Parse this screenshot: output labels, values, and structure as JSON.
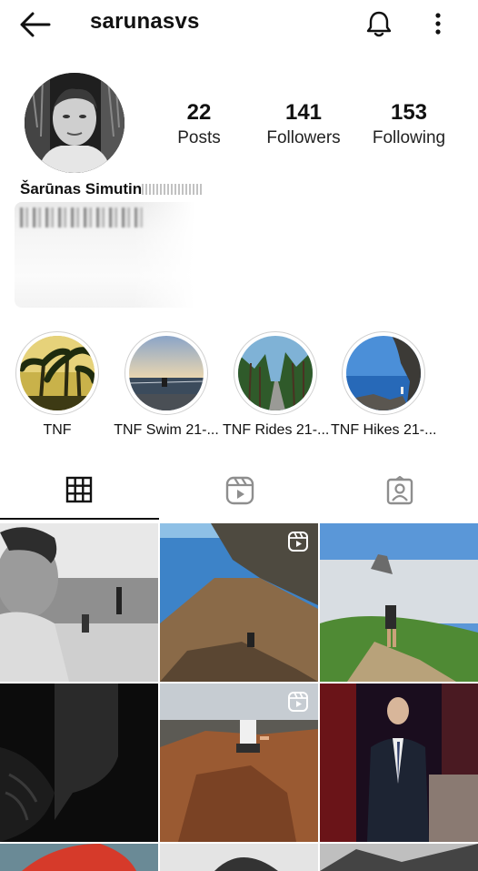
{
  "header": {
    "username": "sarunasvs",
    "icons": {
      "back": "arrow-left-icon",
      "notifications": "bell-icon",
      "more": "more-vertical-icon"
    }
  },
  "profile": {
    "full_name": "Šarūnas Simutin",
    "stats": {
      "posts": {
        "value": "22",
        "label": "Posts"
      },
      "followers": {
        "value": "141",
        "label": "Followers"
      },
      "following": {
        "value": "153",
        "label": "Following"
      }
    }
  },
  "highlights": [
    {
      "label": "TNF"
    },
    {
      "label": "TNF Swim 21-..."
    },
    {
      "label": "TNF Rides 21-..."
    },
    {
      "label": "TNF Hikes 21-..."
    }
  ],
  "tabs": [
    {
      "icon": "grid-icon",
      "active": true
    },
    {
      "icon": "reels-icon",
      "active": false
    },
    {
      "icon": "tagged-icon",
      "active": false
    }
  ],
  "grid": [
    {
      "type": "photo",
      "reel": false
    },
    {
      "type": "photo",
      "reel": true
    },
    {
      "type": "photo",
      "reel": false
    },
    {
      "type": "photo",
      "reel": false
    },
    {
      "type": "photo",
      "reel": true
    },
    {
      "type": "photo",
      "reel": false
    }
  ],
  "colors": {
    "text": "#111111",
    "divider": "#cfcfcf"
  }
}
